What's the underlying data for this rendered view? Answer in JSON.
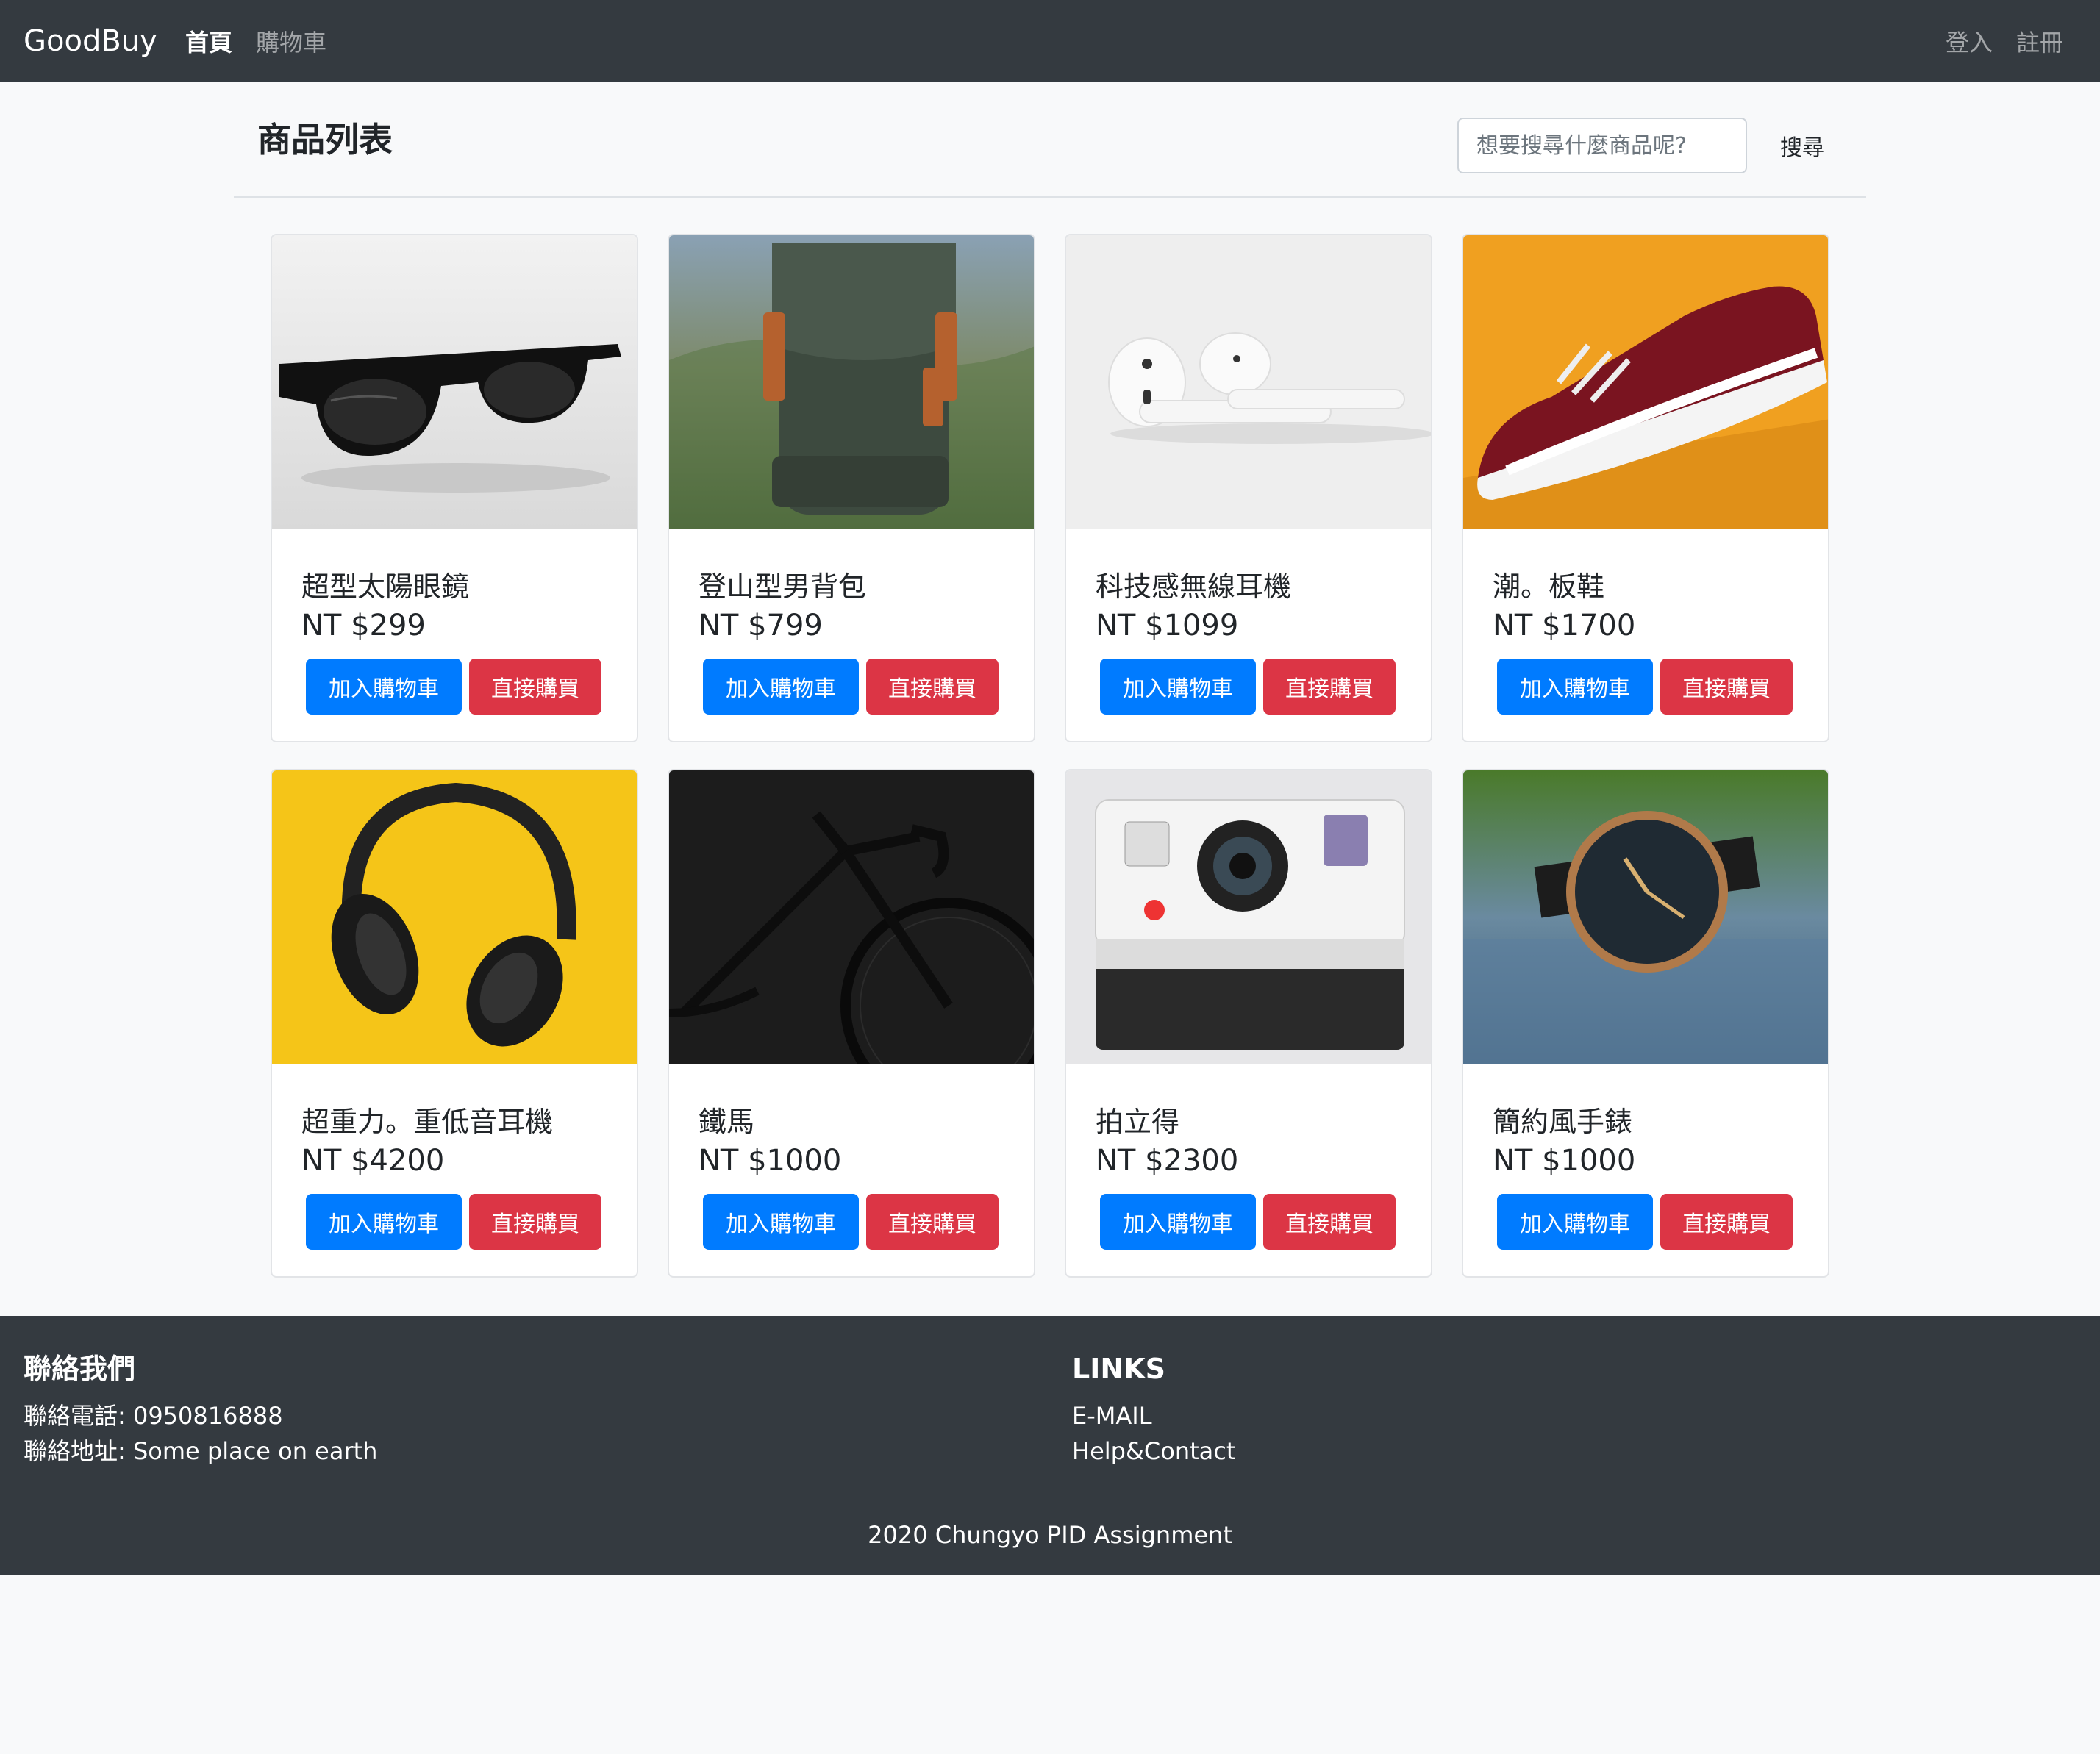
{
  "navbar": {
    "brand": "GoodBuy",
    "home": "首頁",
    "cart": "購物車",
    "login": "登入",
    "register": "註冊"
  },
  "header": {
    "title": "商品列表",
    "search_placeholder": "想要搜尋什麼商品呢?",
    "search_button": "搜尋"
  },
  "buttons": {
    "add_to_cart": "加入購物車",
    "buy_now": "直接購買"
  },
  "products": [
    {
      "name": "超型太陽眼鏡",
      "price": "NT $299",
      "image": "sunglasses"
    },
    {
      "name": "登山型男背包",
      "price": "NT $799",
      "image": "backpack"
    },
    {
      "name": "科技感無線耳機",
      "price": "NT $1099",
      "image": "wireless-earbuds"
    },
    {
      "name": "潮。板鞋",
      "price": "NT $1700",
      "image": "sneaker"
    },
    {
      "name": "超重力。重低音耳機",
      "price": "NT $4200",
      "image": "headphones"
    },
    {
      "name": "鐵馬",
      "price": "NT $1000",
      "image": "bicycle"
    },
    {
      "name": "拍立得",
      "price": "NT $2300",
      "image": "instant-camera"
    },
    {
      "name": "簡約風手錶",
      "price": "NT $1000",
      "image": "wristwatch"
    }
  ],
  "footer": {
    "contact_title": "聯絡我們",
    "phone": "聯絡電話: 0950816888",
    "address": "聯絡地址: Some place on earth",
    "links_title": "LINKS",
    "email": "E-MAIL",
    "help": "Help&Contact",
    "copyright": "2020 Chungyo PID Assignment"
  },
  "colors": {
    "navbar": "#343a40",
    "primary": "#007bff",
    "danger": "#dc3545",
    "background": "#f8f9fa"
  }
}
